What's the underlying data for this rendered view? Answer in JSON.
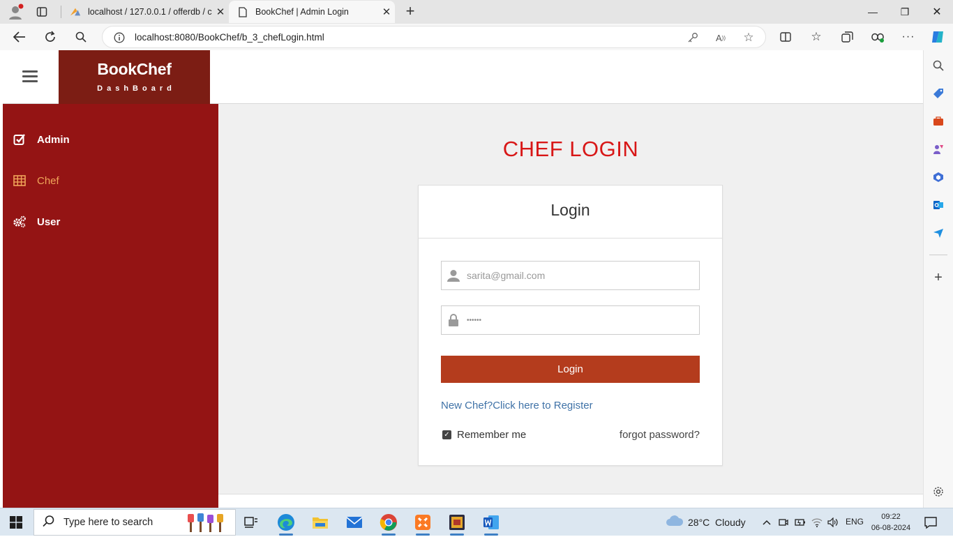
{
  "browser": {
    "tabs": [
      {
        "title": "localhost / 127.0.0.1 / offerdb / c",
        "favicon": "pma-icon"
      },
      {
        "title": "BookChef | Admin Login",
        "favicon": "page-icon"
      }
    ],
    "url": "localhost:8080/BookChef/b_3_chefLogin.html"
  },
  "app": {
    "brand_name": "BookChef",
    "brand_sub": "DashBoard",
    "brand_color": "#7c1d14",
    "sidebar_color": "#941414",
    "sidebar": [
      {
        "label": "Admin",
        "icon": "check-square-icon",
        "active": false
      },
      {
        "label": "Chef",
        "icon": "table-icon",
        "active": true
      },
      {
        "label": "User",
        "icon": "gears-icon",
        "active": false
      }
    ]
  },
  "login": {
    "heading": "CHEF LOGIN",
    "heading_color": "#d81717",
    "box_title": "Login",
    "email_placeholder": "sarita@gmail.com",
    "password_value": "••••••",
    "button_label": "Login",
    "button_color": "#b43c1d",
    "register_link": "New Chef?Click here to Register",
    "remember_label": "Remember me",
    "remember_checked": true,
    "forgot_label": "forgot password?"
  },
  "taskbar": {
    "search_placeholder": "Type here to search",
    "weather": "28°C  Cloudy",
    "language": "ENG",
    "time": "09:22",
    "date": "06-08-2024"
  }
}
